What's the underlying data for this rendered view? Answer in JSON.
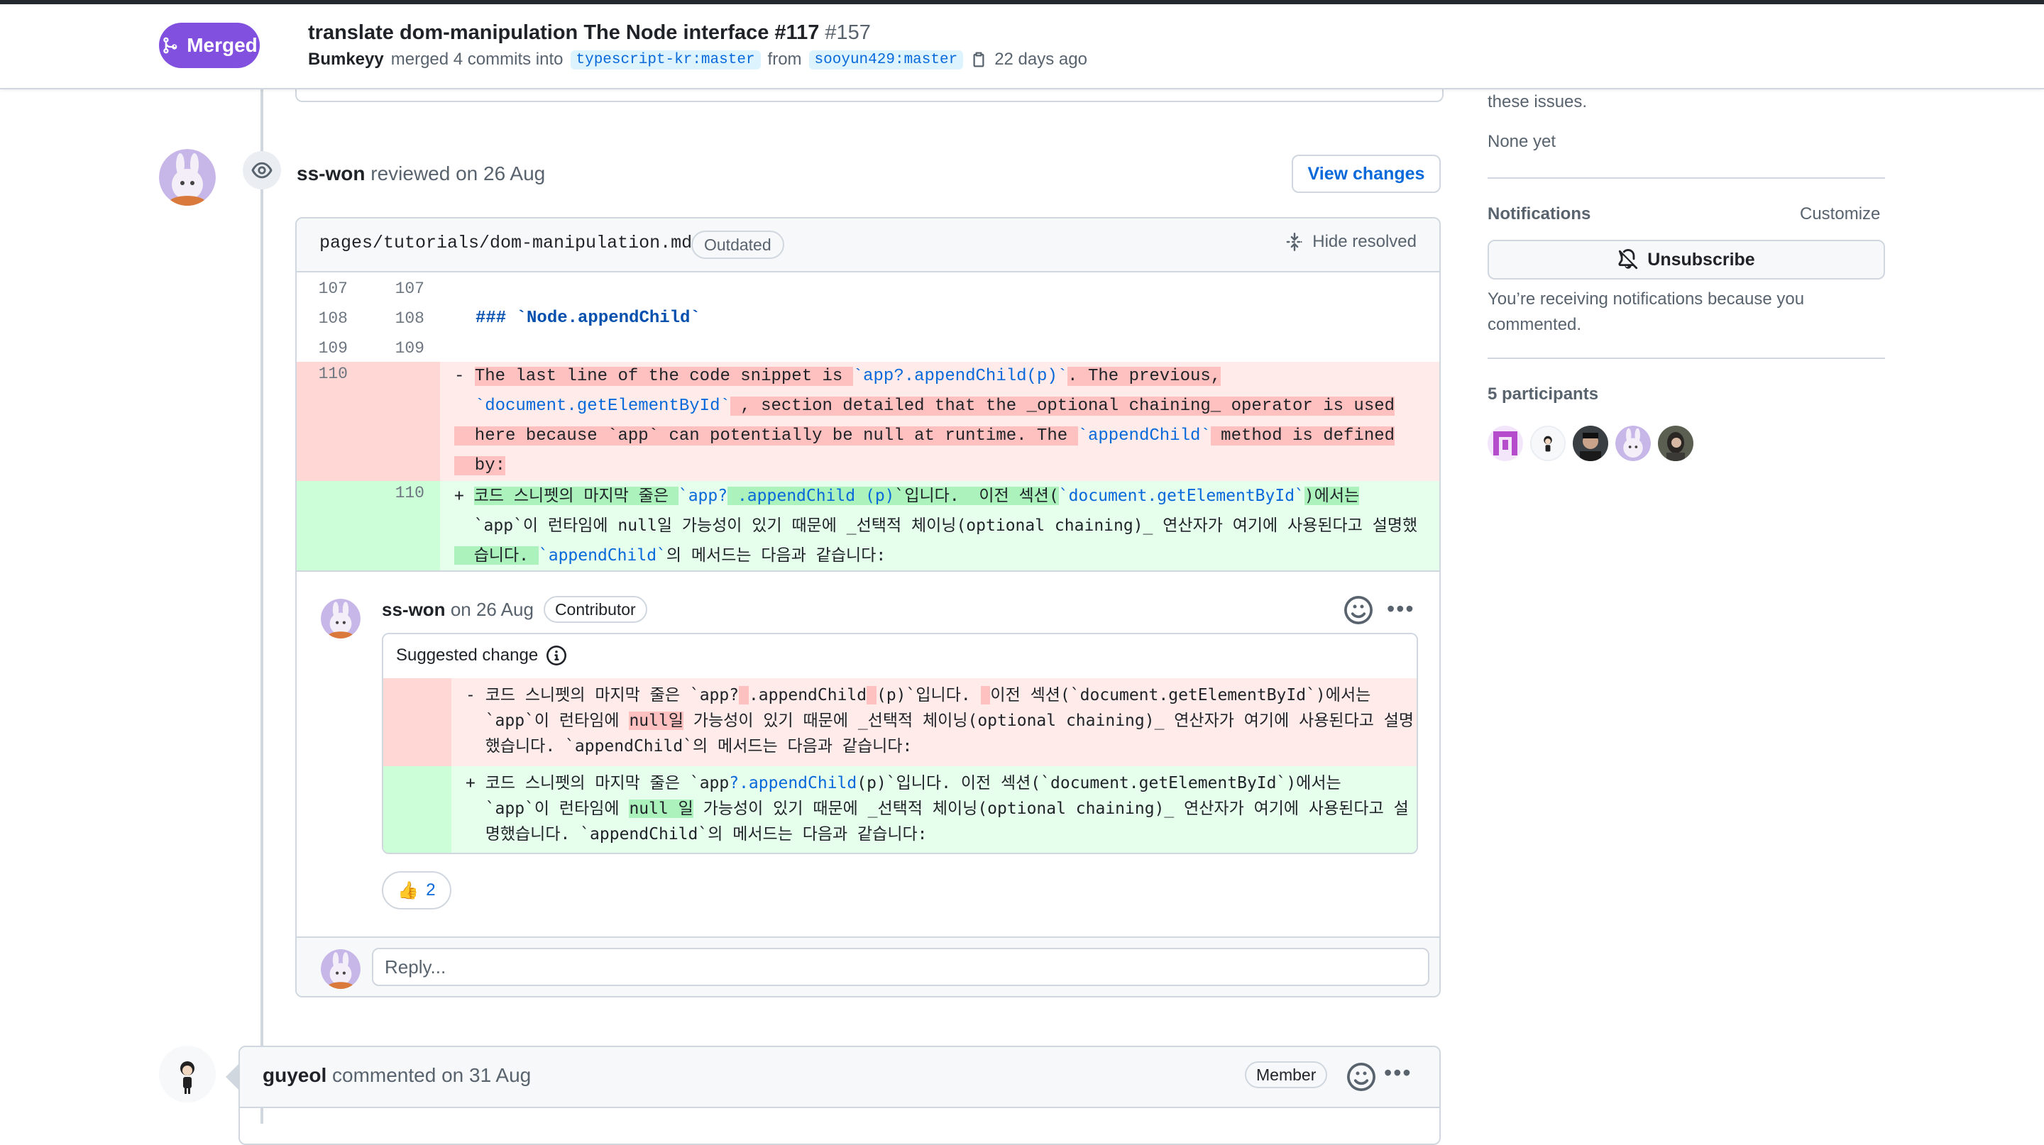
{
  "header": {
    "status": "Merged",
    "title": "translate dom-manipulation The Node interface #117",
    "number": "#157",
    "merger": "Bumkeyy",
    "merged_text": "merged 4 commits into",
    "base_branch": "typescript-kr:master",
    "from_text": "from",
    "head_branch": "sooyun429:master",
    "time": "22 days ago"
  },
  "review": {
    "author": "ss-won",
    "action": "reviewed",
    "date": "on 26 Aug",
    "view_changes": "View changes",
    "file_path": "pages/tutorials/dom-manipulation.md",
    "outdated": "Outdated",
    "hide_resolved": "Hide resolved",
    "lines": [
      {
        "old": "107",
        "new": "107",
        "text": ""
      },
      {
        "old": "108",
        "new": "108",
        "text": "### `Node.appendChild`"
      },
      {
        "old": "109",
        "new": "109",
        "text": ""
      }
    ],
    "deleted": {
      "old": "110",
      "l1_a": "- ",
      "l1_b": "The last line of the code snippet is ",
      "l1_c": "`app?.appendChild(p)`",
      "l1_d": ". The previous,",
      "l2_a": "  ",
      "l2_b": "`document.getElementById`",
      "l2_c": " , section detailed that the _optional chaining_ operator is used",
      "l3": "  here because `app` can potentially be null at runtime. The ",
      "l3_b": "`appendChild`",
      "l3_c": " method is defined",
      "l4": "  by:"
    },
    "added": {
      "new": "110",
      "l1_a": "+ ",
      "l1_b": "코드 스니펫의 마지막 줄은 ",
      "l1_c": "`app?",
      "l1_d": " .appendChild",
      "l1_e": " (p)",
      "l1_f": "`입니다.  이전 섹션(",
      "l1_g": "`document.getElementById`",
      "l1_h": ")에서는",
      "l2": "  `app`이 런타임에 null일 가능성이 있기 때문에 _선택적 체이닝(optional chaining)_ 연산자가 여기에 사용된다고 설명했",
      "l3_a": "  습니다. ",
      "l3_b": "`appendChild`",
      "l3_c": "의 메서드는 다음과 같습니다:"
    }
  },
  "comment": {
    "author": "ss-won",
    "date": "on 26 Aug",
    "role": "Contributor",
    "suggested_change": "Suggested change",
    "del_l1_a": "- 코드 스니펫의 마지막 줄은 `app?",
    "del_l1_b": ".appendChild",
    "del_l1_c": "(p)`입니다. ",
    "del_l1_d": "이전 섹션(`document.getElementById`)에서는",
    "del_l2_a": "  `app`이 런타임에 ",
    "del_l2_b": "null일",
    "del_l2_c": " 가능성이 있기 때문에 _선택적 체이닝(optional chaining)_ 연산자가 여기에 사용된다고 설명",
    "del_l3": "  했습니다. `appendChild`의 메서드는 다음과 같습니다:",
    "add_l1_a": "+ 코드 스니펫의 마지막 줄은 `app",
    "add_l1_b": "?.appendChild",
    "add_l1_c": "(p)`입니다. 이전 섹션(`document.getElementById`)에서는",
    "add_l2_a": "  `app`이 런타임에 ",
    "add_l2_b": "null 일",
    "add_l2_c": " 가능성이 있기 때문에 _선택적 체이닝(optional chaining)_ 연산자가 여기에 사용된다고 설",
    "add_l3": "  명했습니다. `appendChild`의 메서드는 다음과 같습니다:",
    "reaction_count": "2",
    "reply_placeholder": "Reply..."
  },
  "next_comment": {
    "author": "guyeol",
    "action": "commented on 31 Aug",
    "role": "Member"
  },
  "sidebar": {
    "issues_text": "these issues.",
    "none_yet": "None yet",
    "notifications_title": "Notifications",
    "customize": "Customize",
    "unsubscribe": "Unsubscribe",
    "notif_desc": "You’re receiving notifications because you commented.",
    "participants_title": "5 participants"
  },
  "colors": {
    "merged": "#8250df",
    "link": "#0969da",
    "del_bg": "#ffebe9",
    "add_bg": "#e6ffec"
  }
}
